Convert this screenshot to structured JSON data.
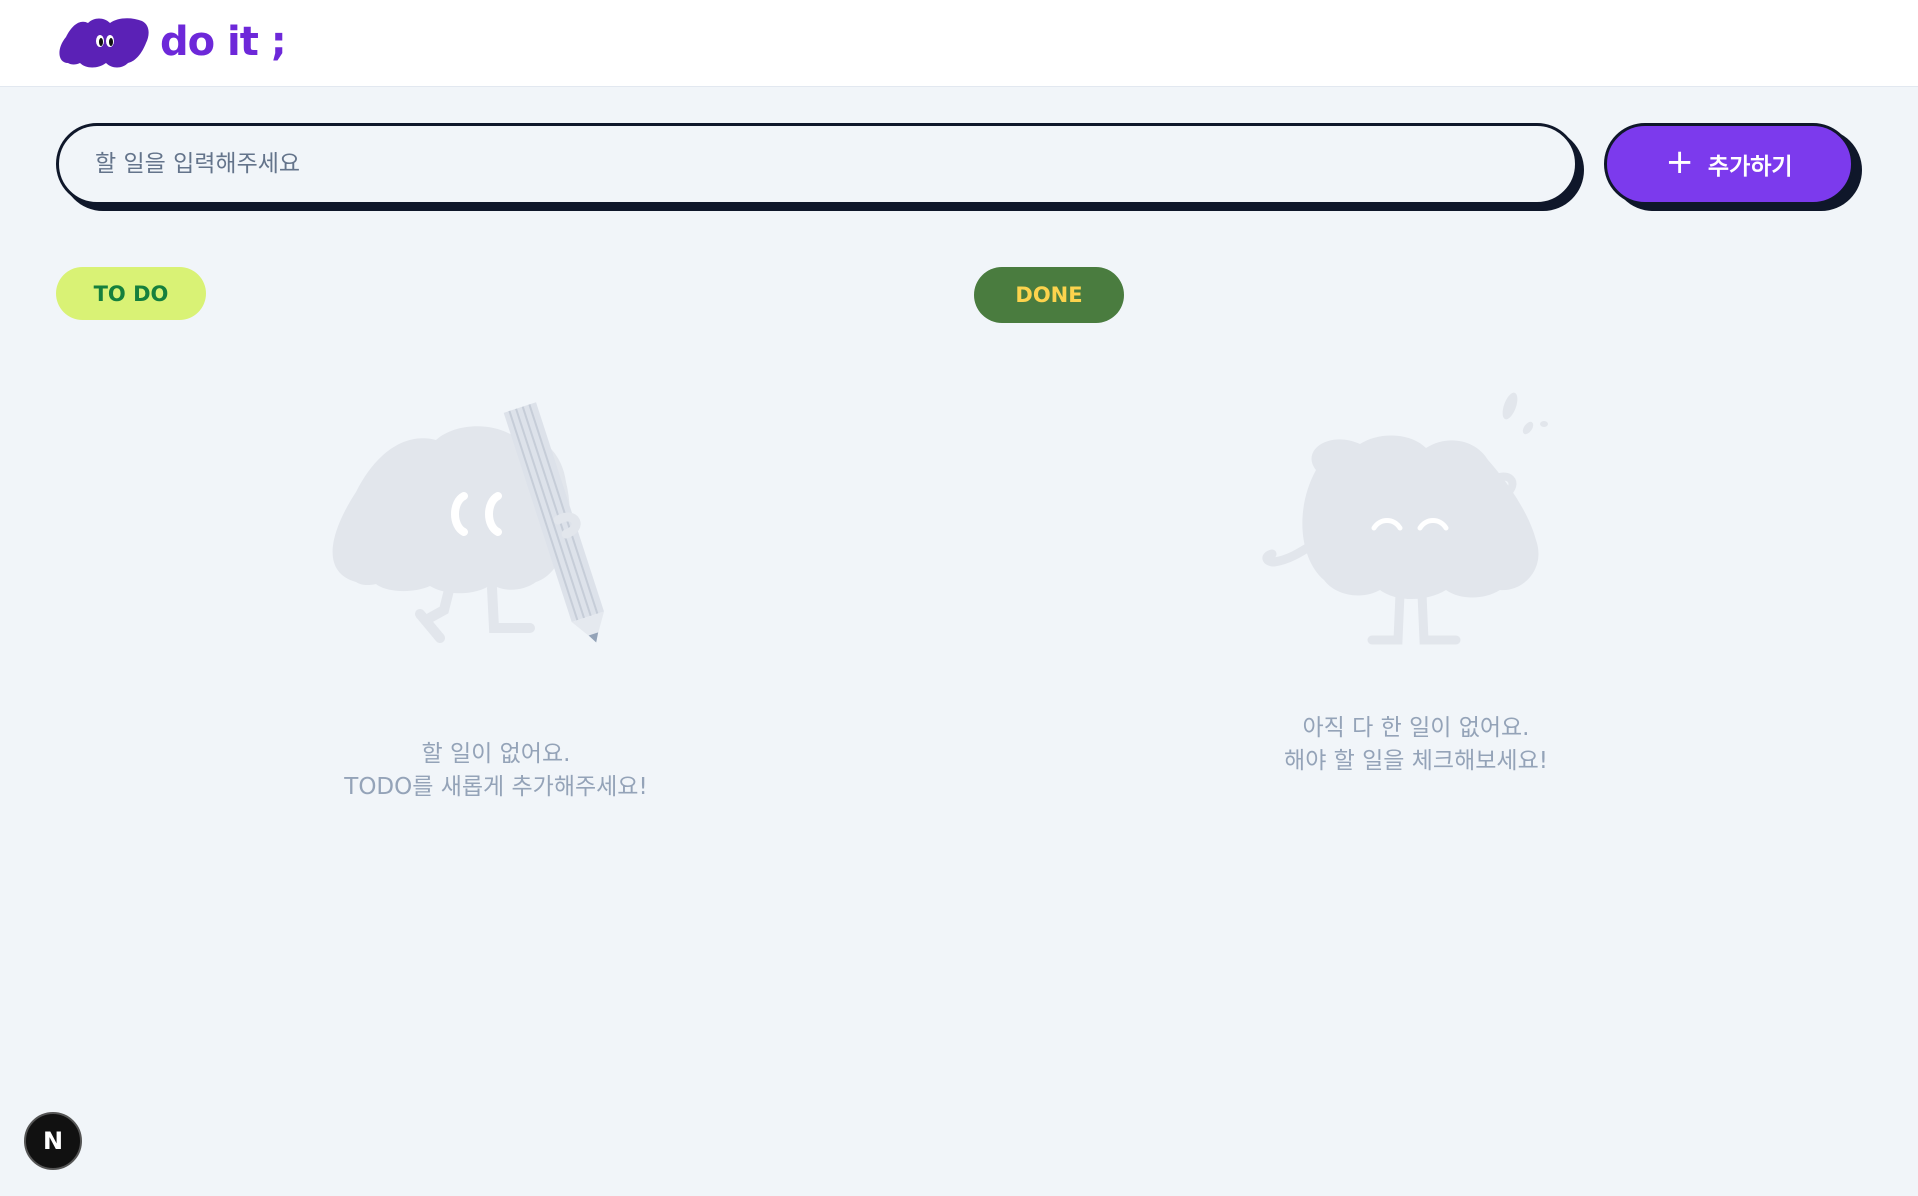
{
  "header": {
    "logo_text": "do it ;",
    "logo_color": "#6d28d9"
  },
  "input": {
    "placeholder": "할 일을 입력해주세요",
    "value": ""
  },
  "add_button": {
    "label": "추가하기",
    "icon": "plus-icon",
    "color": "#7c3aed"
  },
  "todo": {
    "label": "TO DO",
    "empty_line1": "할 일이 없어요.",
    "empty_line2": "TODO를 새롭게 추가해주세요!"
  },
  "done": {
    "label": "DONE",
    "empty_line1": "아직 다 한 일이 없어요.",
    "empty_line2": "해야 할 일을 체크해보세요!"
  },
  "dev_badge": {
    "label": "N"
  }
}
